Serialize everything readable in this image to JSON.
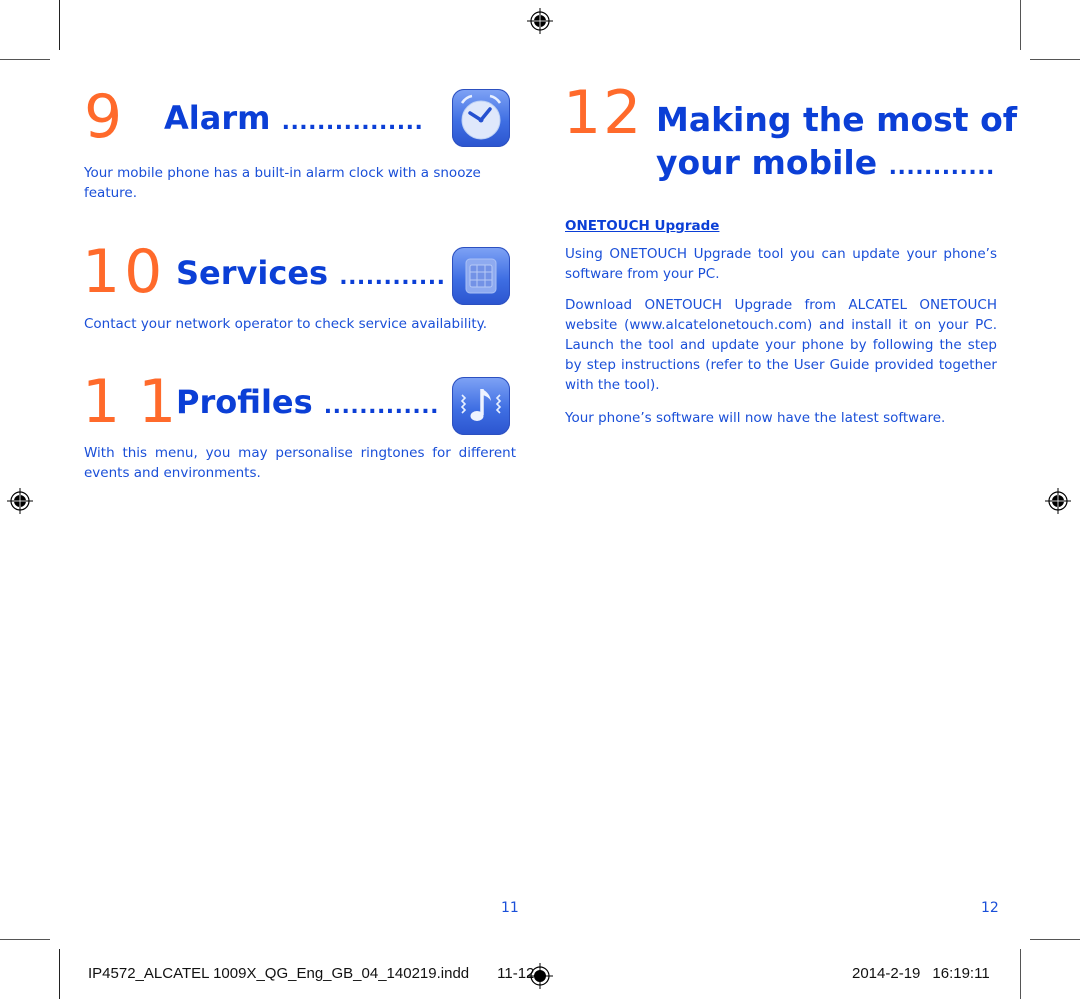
{
  "left_page": {
    "sections": [
      {
        "number": "9",
        "title": "Alarm",
        "leader": "................",
        "icon": "alarm-clock-icon",
        "body": "Your mobile phone has a built-in alarm clock with a snooze feature."
      },
      {
        "number": "10",
        "title": "Services",
        "leader": "............",
        "icon": "sim-card-icon",
        "body": "Contact your network operator to check service availability."
      },
      {
        "number": "11",
        "title": "Profiles",
        "leader": ".............",
        "icon": "music-note-icon",
        "body": "With this menu, you may personalise ringtones for different events and environments."
      }
    ],
    "page_number": "11"
  },
  "right_page": {
    "number": "12",
    "title_line1": "Making the most of",
    "title_line2": "your mobile",
    "leader": "............",
    "subheading": "ONETOUCH Upgrade",
    "paragraphs": [
      "Using ONETOUCH Upgrade tool you can update your phone’s software from your PC.",
      "Download ONETOUCH Upgrade from ALCATEL ONETOUCH website (www.alcatelonetouch.com) and install it on your PC. Launch the tool and update your phone by following the step by step instructions (refer to the User Guide provided together with the tool).",
      "Your phone’s software will now have the latest software."
    ],
    "page_number": "12"
  },
  "footer": {
    "file_name": "IP4572_ALCATEL 1009X_QG_Eng_GB_04_140219.indd",
    "pages": "11-12",
    "date": "2014-2-19",
    "time": "16:19:11"
  },
  "colors": {
    "chapter_number": "#ff6a2b",
    "title": "#0b3fd6",
    "body": "#1a4fd8"
  }
}
